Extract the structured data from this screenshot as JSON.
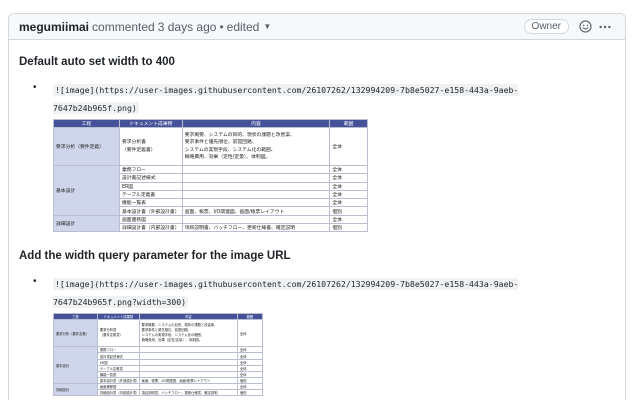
{
  "comment": {
    "author": "megumiimai",
    "action": "commented",
    "time": "3 days ago",
    "separator": "•",
    "edited": "edited",
    "owner_badge": "Owner"
  },
  "sections": [
    {
      "heading": "Default auto set width to 400",
      "code_line1": "![image](https://user-images.githubusercontent.com/26107262/132994209-7b8e5027-e158-443a-9aeb-",
      "code_line2": "7647b24b965f.png)"
    },
    {
      "heading": "Add the width query parameter for the image URL",
      "code_line1": "![image](https://user-images.githubusercontent.com/26107262/132994209-7b8e5027-e158-443a-9aeb-",
      "code_line2": "7647b24b965f.png?width=300)"
    }
  ],
  "table": {
    "headers": [
      "工程",
      "ドキュメント成果物",
      "内容",
      "範囲"
    ],
    "rows": [
      {
        "proc": "要求分析（要件定義）",
        "doc": "要求分析書\n（要件定義書）",
        "content": "要求概要、システムの目的、現状の課題と改善案、\n要求事件と優先順位、前提回路、\nシステムの実現手段、システム化の範囲、\n概略費用、効果（定性/定量）、体制図。",
        "scope": "全体",
        "tall": true
      },
      {
        "proc": "基本設計",
        "doc": "業務フロー",
        "content": "",
        "scope": "全体"
      },
      {
        "proc": "",
        "doc": "設計書記述様式",
        "content": "",
        "scope": "全体"
      },
      {
        "proc": "",
        "doc": "ER図",
        "content": "",
        "scope": "全体"
      },
      {
        "proc": "",
        "doc": "テーブル定義書",
        "content": "",
        "scope": "全体"
      },
      {
        "proc": "",
        "doc": "機能一覧表",
        "content": "",
        "scope": "全体"
      },
      {
        "proc": "",
        "doc": "基本設計書（外部設計書）",
        "content": "画面、帳票、I/O関連図、画面/帳票レイアウト",
        "scope": "個別"
      },
      {
        "proc": "詳細設計",
        "doc": "画面遷移図",
        "content": "",
        "scope": "全体"
      },
      {
        "proc": "",
        "doc": "詳細設計書（内部設計書）",
        "content": "項目説明書、バッチフロー、更新仕様書、確定説明",
        "scope": "個別"
      }
    ]
  },
  "icons": {
    "caret": "caret-down-icon",
    "emoji": "smiley-icon",
    "more": "kebab-horizontal-icon"
  },
  "colors": {
    "table_header": "#45529a",
    "process_cell": "#cfd5ea",
    "header_bg": "#f6f8fa",
    "border": "#d0d7de"
  }
}
